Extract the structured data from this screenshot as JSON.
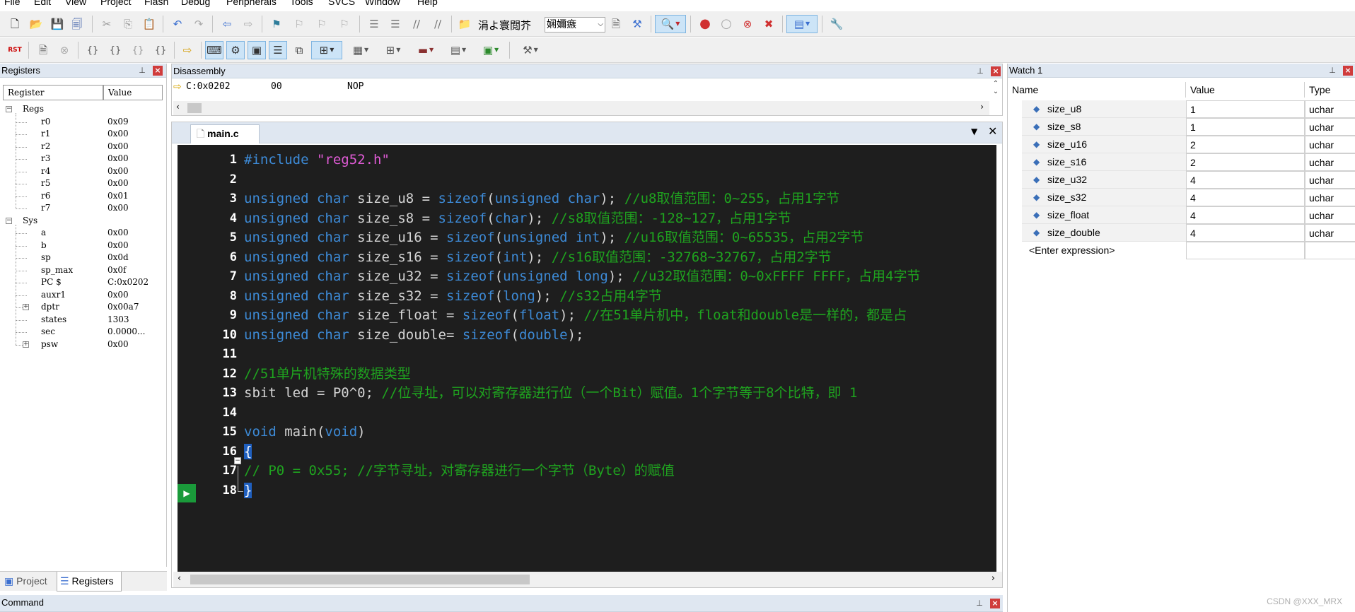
{
  "menu": [
    "File",
    "Edit",
    "View",
    "Project",
    "Flash",
    "Debug",
    "Peripherals",
    "Tools",
    "SVCS",
    "Window",
    "Help"
  ],
  "toolbar": {
    "target_text": "涓よ寰閲芥",
    "build_combo": "娴嬭瘯",
    "rst_label": "RST"
  },
  "registers": {
    "title": "Registers",
    "col_register": "Register",
    "col_value": "Value",
    "groups": [
      {
        "name": "Regs",
        "items": [
          {
            "name": "r0",
            "value": "0x09"
          },
          {
            "name": "r1",
            "value": "0x00"
          },
          {
            "name": "r2",
            "value": "0x00"
          },
          {
            "name": "r3",
            "value": "0x00"
          },
          {
            "name": "r4",
            "value": "0x00"
          },
          {
            "name": "r5",
            "value": "0x00"
          },
          {
            "name": "r6",
            "value": "0x01"
          },
          {
            "name": "r7",
            "value": "0x00"
          }
        ]
      },
      {
        "name": "Sys",
        "items": [
          {
            "name": "a",
            "value": "0x00"
          },
          {
            "name": "b",
            "value": "0x00"
          },
          {
            "name": "sp",
            "value": "0x0d"
          },
          {
            "name": "sp_max",
            "value": "0x0f"
          },
          {
            "name": "PC  $",
            "value": "C:0x0202"
          },
          {
            "name": "auxr1",
            "value": "0x00"
          },
          {
            "name": "dptr",
            "value": "0x00a7"
          },
          {
            "name": "states",
            "value": "1303"
          },
          {
            "name": "sec",
            "value": "0.0000..."
          },
          {
            "name": "psw",
            "value": "0x00"
          }
        ]
      }
    ],
    "tabs": [
      "Project",
      "Registers"
    ]
  },
  "disassembly": {
    "title": "Disassembly",
    "line": {
      "addr": "C:0x0202",
      "bytes": "00",
      "mnemonic": "NOP"
    }
  },
  "editor": {
    "tab": "main.c",
    "lines": [
      [
        [
          "pp",
          "#include "
        ],
        [
          "str",
          "\"reg52.h\""
        ]
      ],
      [],
      [
        [
          "kw",
          "unsigned char "
        ],
        [
          "id",
          "size_u8 = "
        ],
        [
          "kw",
          "sizeof"
        ],
        [
          "id",
          "("
        ],
        [
          "kw",
          "unsigned char"
        ],
        [
          "id",
          "); "
        ],
        [
          "cm",
          "//u8取值范围：0~255，占用1字节"
        ]
      ],
      [
        [
          "kw",
          "unsigned char "
        ],
        [
          "id",
          "size_s8 = "
        ],
        [
          "kw",
          "sizeof"
        ],
        [
          "id",
          "("
        ],
        [
          "kw",
          "char"
        ],
        [
          "id",
          "); "
        ],
        [
          "cm",
          "//s8取值范围：-128~127，占用1字节"
        ]
      ],
      [
        [
          "kw",
          "unsigned char "
        ],
        [
          "id",
          "size_u16 = "
        ],
        [
          "kw",
          "sizeof"
        ],
        [
          "id",
          "("
        ],
        [
          "kw",
          "unsigned int"
        ],
        [
          "id",
          "); "
        ],
        [
          "cm",
          "//u16取值范围：0~65535，占用2字节"
        ]
      ],
      [
        [
          "kw",
          "unsigned char "
        ],
        [
          "id",
          "size_s16 = "
        ],
        [
          "kw",
          "sizeof"
        ],
        [
          "id",
          "("
        ],
        [
          "kw",
          "int"
        ],
        [
          "id",
          "); "
        ],
        [
          "cm",
          "//s16取值范围：-32768~32767，占用2字节"
        ]
      ],
      [
        [
          "kw",
          "unsigned char "
        ],
        [
          "id",
          "size_u32 = "
        ],
        [
          "kw",
          "sizeof"
        ],
        [
          "id",
          "("
        ],
        [
          "kw",
          "unsigned long"
        ],
        [
          "id",
          "); "
        ],
        [
          "cm",
          "//u32取值范围：0~0xFFFF FFFF，占用4字节"
        ]
      ],
      [
        [
          "kw",
          "unsigned char "
        ],
        [
          "id",
          "size_s32 = "
        ],
        [
          "kw",
          "sizeof"
        ],
        [
          "id",
          "("
        ],
        [
          "kw",
          "long"
        ],
        [
          "id",
          "); "
        ],
        [
          "cm",
          "//s32占用4字节"
        ]
      ],
      [
        [
          "kw",
          "unsigned char "
        ],
        [
          "id",
          "size_float = "
        ],
        [
          "kw",
          "sizeof"
        ],
        [
          "id",
          "("
        ],
        [
          "kw",
          "float"
        ],
        [
          "id",
          "); "
        ],
        [
          "cm",
          "//在51单片机中，float和double是一样的，都是占"
        ]
      ],
      [
        [
          "kw",
          "unsigned char "
        ],
        [
          "id",
          "size_double= "
        ],
        [
          "kw",
          "sizeof"
        ],
        [
          "id",
          "("
        ],
        [
          "kw",
          "double"
        ],
        [
          "id",
          ");"
        ]
      ],
      [],
      [
        [
          "cm",
          "//51单片机特殊的数据类型"
        ]
      ],
      [
        [
          "id",
          "sbit led = P0^0; "
        ],
        [
          "cm",
          "//位寻址，可以对寄存器进行位（一个Bit）赋值。1个字节等于8个比特，即 1"
        ]
      ],
      [],
      [
        [
          "kw",
          "void "
        ],
        [
          "id",
          "main("
        ],
        [
          "kw",
          "void"
        ],
        [
          "id",
          ")"
        ]
      ],
      [
        [
          "id",
          "{"
        ]
      ],
      [
        [
          "cm",
          "// P0 = 0x55; //字节寻址，对寄存器进行一个字节（Byte）的赋值"
        ]
      ],
      [
        [
          "id",
          "}"
        ]
      ]
    ]
  },
  "command": {
    "title": "Command"
  },
  "watch": {
    "title": "Watch 1",
    "col_name": "Name",
    "col_value": "Value",
    "col_type": "Type",
    "rows": [
      {
        "name": "size_u8",
        "value": "1",
        "type": "uchar"
      },
      {
        "name": "size_s8",
        "value": "1",
        "type": "uchar"
      },
      {
        "name": "size_u16",
        "value": "2",
        "type": "uchar"
      },
      {
        "name": "size_s16",
        "value": "2",
        "type": "uchar"
      },
      {
        "name": "size_u32",
        "value": "4",
        "type": "uchar"
      },
      {
        "name": "size_s32",
        "value": "4",
        "type": "uchar"
      },
      {
        "name": "size_float",
        "value": "4",
        "type": "uchar"
      },
      {
        "name": "size_double",
        "value": "4",
        "type": "uchar"
      }
    ],
    "enter_expression": "<Enter expression>"
  },
  "watermark": "CSDN @XXX_MRX"
}
